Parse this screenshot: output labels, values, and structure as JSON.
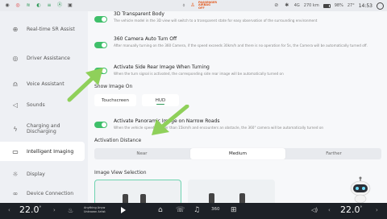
{
  "status_bar": {
    "time": "14:53",
    "temperature": "27°",
    "battery_percent": "98%",
    "range": "270 km",
    "signal": "4G",
    "passenger_airbag": "PASSENGER AIRBAG OFF"
  },
  "sidebar": {
    "items": [
      {
        "label": "Real-time SR Assist",
        "icon": "sr-icon"
      },
      {
        "label": "Driver Assistance",
        "icon": "steering-wheel-icon"
      },
      {
        "label": "Voice Assistant",
        "icon": "voice-icon"
      },
      {
        "label": "Sounds",
        "icon": "speaker-icon"
      },
      {
        "label": "Charging and Discharging",
        "icon": "lightning-icon"
      },
      {
        "label": "Intelligent Imaging",
        "icon": "camera-icon",
        "active": true
      },
      {
        "label": "Display",
        "icon": "sun-icon"
      },
      {
        "label": "Device Connection",
        "icon": "link-icon"
      }
    ]
  },
  "main": {
    "transparent_body": {
      "title": "3D Transparent Body",
      "desc": "The vehicle model in the 3D view will switch to a transparent state for easy observation of the surrounding environment",
      "enabled": true
    },
    "camera_auto_off": {
      "title": "360 Camera Auto Turn Off",
      "desc": "After manually turning on the 360 Camera, if the speed exceeds 30km/h and there is no operation for 5s, the Camera will be automatically turned off.",
      "enabled": true
    },
    "side_rear_turning": {
      "title": "Activate Side Rear Image When Turning",
      "desc": "When the turn signal is activated, the corresponding side rear image will be automatically turned on",
      "enabled": true
    },
    "show_image_on": {
      "label": "Show Image On",
      "options": [
        "Touchscreen",
        "HUD"
      ],
      "selected": "HUD"
    },
    "narrow_roads": {
      "title": "Activate Panoramic Image on Narrow Roads",
      "desc": "When the vehicle speed is lower than 15km/h and encounters an obstacle, the 360° camera will be automatically turned on",
      "enabled": true
    },
    "activation_distance": {
      "label": "Activation Distance",
      "options": [
        "Near",
        "Medium",
        "Farther"
      ],
      "selected": "Medium"
    },
    "image_view_selection": {
      "label": "Image View Selection"
    }
  },
  "dock": {
    "left_temp": "22.0",
    "right_temp": "22.0",
    "temp_unit": "°",
    "track_title": "Anything Anyw",
    "track_artist": "Unknown Artist",
    "view_360": "360"
  },
  "colors": {
    "accent_green": "#3fbf6a",
    "arrow_green": "#8fd05a",
    "dock_bg": "#1d2127"
  }
}
